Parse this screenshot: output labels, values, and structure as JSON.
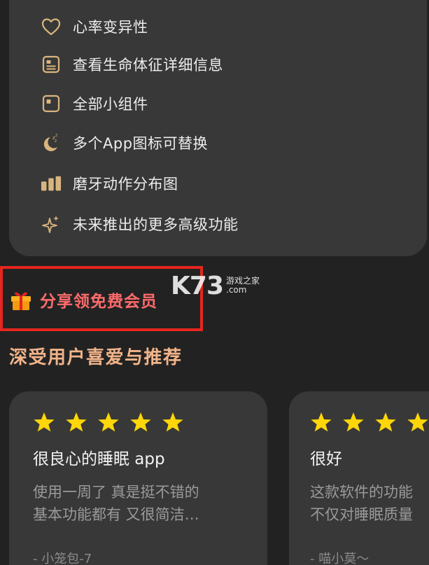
{
  "features": {
    "items": [
      {
        "icon": "heart-icon",
        "label": "心率变异性"
      },
      {
        "icon": "vitals-card-icon",
        "label": "查看生命体征详细信息"
      },
      {
        "icon": "widget-icon",
        "label": "全部小组件"
      },
      {
        "icon": "moon-sleep-icon",
        "label": "多个App图标可替换"
      },
      {
        "icon": "bar-chart-icon",
        "label": "磨牙动作分布图"
      },
      {
        "icon": "sparkle-icon",
        "label": "未来推出的更多高级功能"
      }
    ]
  },
  "share": {
    "label": "分享领免费会员",
    "icon": "gift-icon"
  },
  "watermark": {
    "main": "K73",
    "cn": "游戏之家",
    "com": ".com"
  },
  "reviews_section": {
    "title": "深受用户喜爱与推荐"
  },
  "reviews": [
    {
      "stars": 5,
      "title": "很良心的睡眠 app",
      "body_line1": "使用一周了 真是挺不错的",
      "body_line2": "基本功能都有 又很简洁…",
      "author": "- 小笼包-7"
    },
    {
      "stars": 5,
      "title": "很好",
      "body_line1": "这款软件的功能",
      "body_line2": "不仅对睡眠质量",
      "author": "- 喵小莫～"
    }
  ],
  "colors": {
    "background": "#222222",
    "card": "#383838",
    "accent_gold": "#d9b57e",
    "share_red": "#ff6b6b",
    "section_title": "#f2b48a",
    "star_yellow": "#ffd60a",
    "highlight_red": "#e5261f"
  }
}
